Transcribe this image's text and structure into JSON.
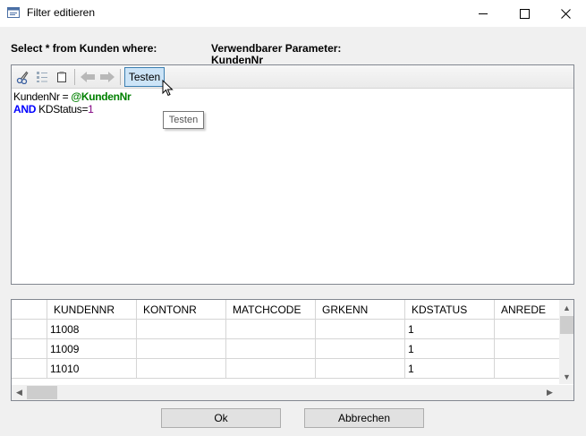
{
  "window": {
    "title": "Filter editieren",
    "icon": "form-icon",
    "controls": [
      "minimize-icon",
      "maximize-icon",
      "close-icon"
    ]
  },
  "labels": {
    "select_from": "Select * from Kunden where:",
    "param_heading": "Verwendbarer Parameter:",
    "param_name": "KundenNr"
  },
  "toolbar": {
    "icons": [
      "cut-icon",
      "list-icon",
      "copy-icon",
      "back-arrow-icon",
      "forward-arrow-icon"
    ],
    "test_label": "Testen"
  },
  "tooltip": {
    "text": "Testen"
  },
  "editor": {
    "line1": {
      "field": "KundenNr",
      "op": " = ",
      "param": "@KundenNr"
    },
    "line2": {
      "keyword": "AND",
      "field": " KDStatus",
      "op": "=",
      "value": "1"
    }
  },
  "grid": {
    "columns": [
      "KUNDENNR",
      "KONTONR",
      "MATCHCODE",
      "GRKENN",
      "KDSTATUS",
      "ANREDE"
    ],
    "rows": [
      [
        "11008",
        "",
        "",
        "",
        "1",
        ""
      ],
      [
        "11009",
        "",
        "",
        "",
        "1",
        ""
      ],
      [
        "11010",
        "",
        "",
        "",
        "1",
        ""
      ]
    ]
  },
  "buttons": {
    "ok": "Ok",
    "cancel": "Abbrechen"
  },
  "colors": {
    "param": "#008000",
    "keyword": "#0000ff",
    "number": "#800080",
    "test_button": "#cce4f7"
  }
}
